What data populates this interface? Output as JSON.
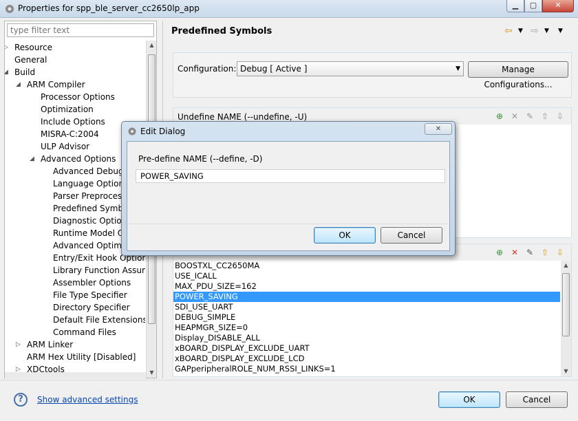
{
  "window": {
    "title": "Properties for spp_ble_server_cc2650lp_app",
    "min_glyph": "▁",
    "max_glyph": "▢",
    "close_glyph": "✕"
  },
  "filter": {
    "placeholder": "type filter text"
  },
  "tree": [
    {
      "label": "Resource",
      "level": 0,
      "toggle": "▷"
    },
    {
      "label": "General",
      "level": 0,
      "toggle": ""
    },
    {
      "label": "Build",
      "level": 0,
      "toggle": "◢"
    },
    {
      "label": "ARM Compiler",
      "level": 1,
      "toggle": "◢"
    },
    {
      "label": "Processor Options",
      "level": 2,
      "toggle": ""
    },
    {
      "label": "Optimization",
      "level": 2,
      "toggle": ""
    },
    {
      "label": "Include Options",
      "level": 2,
      "toggle": ""
    },
    {
      "label": "MISRA-C:2004",
      "level": 2,
      "toggle": ""
    },
    {
      "label": "ULP Advisor",
      "level": 2,
      "toggle": ""
    },
    {
      "label": "Advanced Options",
      "level": 2,
      "toggle": "◢"
    },
    {
      "label": "Advanced Debug Options",
      "level": 3,
      "toggle": ""
    },
    {
      "label": "Language Options",
      "level": 3,
      "toggle": ""
    },
    {
      "label": "Parser Preprocessing Options",
      "level": 3,
      "toggle": ""
    },
    {
      "label": "Predefined Symbols",
      "level": 3,
      "toggle": ""
    },
    {
      "label": "Diagnostic Options",
      "level": 3,
      "toggle": ""
    },
    {
      "label": "Runtime Model Options",
      "level": 3,
      "toggle": ""
    },
    {
      "label": "Advanced Optimizations",
      "level": 3,
      "toggle": ""
    },
    {
      "label": "Entry/Exit Hook Options",
      "level": 3,
      "toggle": ""
    },
    {
      "label": "Library Function Assumptions",
      "level": 3,
      "toggle": ""
    },
    {
      "label": "Assembler Options",
      "level": 3,
      "toggle": ""
    },
    {
      "label": "File Type Specifier",
      "level": 3,
      "toggle": ""
    },
    {
      "label": "Directory Specifier",
      "level": 3,
      "toggle": ""
    },
    {
      "label": "Default File Extensions",
      "level": 3,
      "toggle": ""
    },
    {
      "label": "Command Files",
      "level": 3,
      "toggle": ""
    },
    {
      "label": "ARM Linker",
      "level": 1,
      "toggle": "▷"
    },
    {
      "label": "ARM Hex Utility  [Disabled]",
      "level": 1,
      "toggle": ""
    },
    {
      "label": "XDCtools",
      "level": 1,
      "toggle": "▷"
    }
  ],
  "page": {
    "title": "Predefined Symbols",
    "config_label": "Configuration:",
    "config_value": "Debug  [ Active ]",
    "manage_label": "Manage Configurations...",
    "undefine_label": "Undefine NAME (--undefine, -U)",
    "define_symbols": [
      "BOOSTXL_CC2650MA",
      "USE_ICALL",
      "MAX_PDU_SIZE=162",
      "POWER_SAVING",
      "SDI_USE_UART",
      "DEBUG_SIMPLE",
      "HEAPMGR_SIZE=0",
      "Display_DISABLE_ALL",
      "xBOARD_DISPLAY_EXCLUDE_UART",
      "xBOARD_DISPLAY_EXCLUDE_LCD",
      "GAPperipheralROLE_NUM_RSSI_LINKS=1"
    ],
    "selected_symbol": "POWER_SAVING"
  },
  "bottom": {
    "help_glyph": "?",
    "advanced_link": "Show advanced settings",
    "ok_label": "OK",
    "cancel_label": "Cancel"
  },
  "edit_dialog": {
    "title": "Edit Dialog",
    "close_glyph": "✕",
    "field_label": "Pre-define NAME (--define, -D)",
    "field_value": "POWER_SAVING",
    "ok_label": "OK",
    "cancel_label": "Cancel"
  },
  "colors": {
    "selection": "#3399ff",
    "link": "#0645ad",
    "titlebar": "#c9d9ea"
  }
}
